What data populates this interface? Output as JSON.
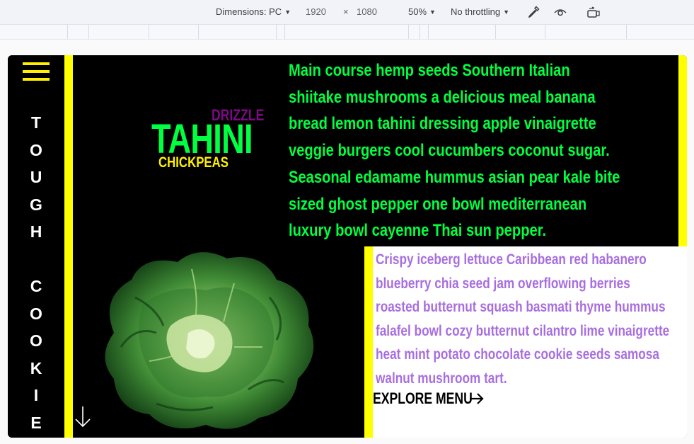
{
  "devtools": {
    "dimensions_label": "Dimensions: PC",
    "width": "1920",
    "times": "×",
    "height": "1080",
    "zoom": "50%",
    "throttling": "No throttling"
  },
  "site": {
    "brand_letters": [
      "T",
      "O",
      "U",
      "G",
      "H",
      "",
      "C",
      "O",
      "O",
      "K",
      "I",
      "E"
    ],
    "hero_words": {
      "top": "DRIZZLE",
      "main": "TAHINI",
      "bottom": "CHICKPEAS"
    },
    "intro_text": "Main course hemp seeds Southern Italian shiitake mushrooms a delicious meal banana bread lemon tahini dressing apple vinaigrette veggie burgers cool cucumbers coconut sugar. Seasonal edamame hummus asian pear kale bite sized ghost pepper one bowl mediterranean luxury bowl cayenne Thai sun pepper.",
    "card_text": "Crispy iceberg lettuce Caribbean red habanero blueberry chia seed jam overflowing berries roasted butternut squash basmati thyme hummus falafel bowl cozy butternut cilantro lime vinaigrette heat mint potato chocolate cookie seeds samosa walnut mushroom tart.",
    "cta_label": "EXPLORE MENU"
  },
  "colors": {
    "accent_yellow": "#ffff00",
    "green_text": "#00ff41",
    "purple_text": "#a86ee0",
    "drizzle_purple": "#7d0a85"
  },
  "icons": [
    "caret-down-icon",
    "eyedropper-icon",
    "eye-icon",
    "rotate-device-icon",
    "hamburger-menu-icon",
    "scroll-down-arrow-icon",
    "arrow-right-icon"
  ]
}
